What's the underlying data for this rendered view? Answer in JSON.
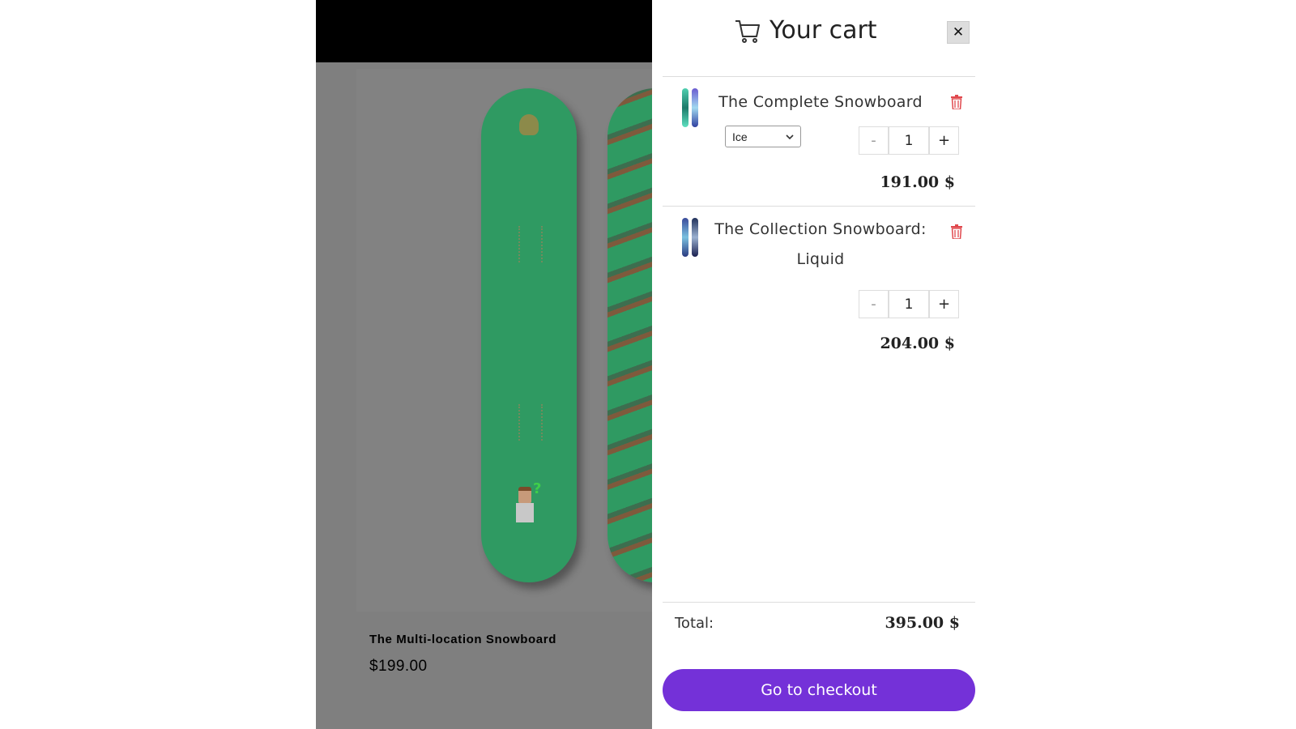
{
  "store": {
    "product_title": "The Multi-location Snowboard",
    "product_price": "$199.00"
  },
  "cart": {
    "title": "Your cart",
    "close_label": "✕",
    "items": [
      {
        "name": "The Complete Snowboard",
        "variant": "Ice",
        "quantity": "1",
        "minus": "-",
        "plus": "+",
        "price": "191.00 $"
      },
      {
        "name": "The Collection Snowboard: Liquid",
        "quantity": "1",
        "minus": "-",
        "plus": "+",
        "price": "204.00 $"
      }
    ],
    "total_label": "Total:",
    "total_value": "395.00 $",
    "checkout_label": "Go to checkout"
  },
  "colors": {
    "overlay": "#7f7f7f",
    "checkout": "#7431d8",
    "trash": "#e0484d",
    "board": "#2f9a62"
  }
}
